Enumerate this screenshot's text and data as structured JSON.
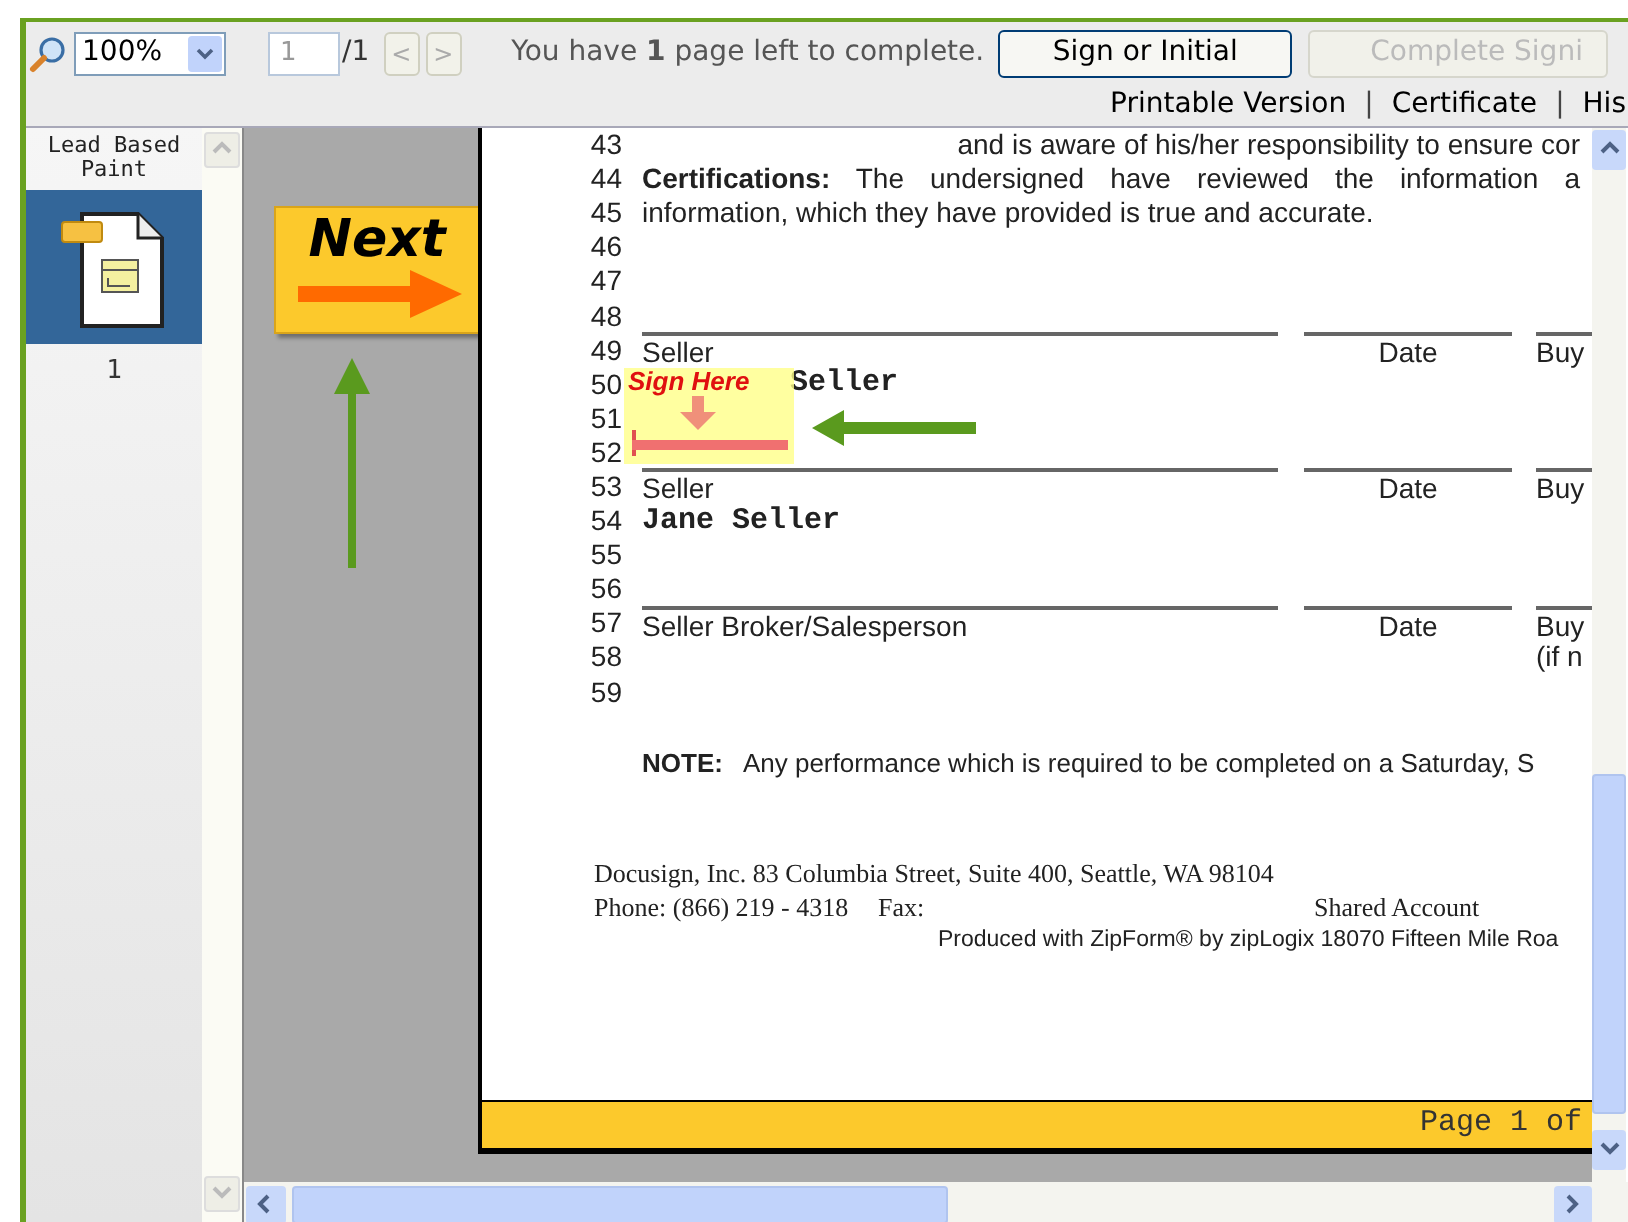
{
  "toolbar": {
    "zoom": "100%",
    "page_input": "1",
    "page_total": "/1",
    "prev": "<",
    "next": ">",
    "message": "You have **1** page left to complete.",
    "buttons": [
      {
        "label": "Sign or Initial",
        "disabled": false
      },
      {
        "label": "Complete Signi",
        "disabled": true
      }
    ],
    "links": [
      {
        "kind": "link",
        "text": "Printable Version"
      },
      {
        "kind": "separator",
        "text": "|"
      },
      {
        "kind": "link",
        "text": "Certificate"
      },
      {
        "kind": "separator",
        "text": "|"
      },
      {
        "kind": "link",
        "text": "His"
      }
    ]
  },
  "sidebar": {
    "title": "Lead Based Paint",
    "pages": [
      {
        "label": "1",
        "selected": true
      }
    ]
  },
  "next_button": "Next",
  "document": {
    "rows": [
      {
        "num": "43",
        "kind": "continued",
        "text": "and is aware of his/her responsibility to ensure cor"
      },
      {
        "num": "44",
        "kind": "justified",
        "text": "**Certifications:** The undersigned have reviewed the information a"
      },
      {
        "num": "45",
        "kind": "text",
        "text": "information, which they have provided is true and accurate."
      },
      {
        "num": "46",
        "kind": "blank"
      },
      {
        "num": "47",
        "kind": "blank"
      },
      {
        "num": "48",
        "kind": "blank"
      },
      {
        "num": "49",
        "kind": "labels",
        "cells": [
          "Seller",
          "Date",
          "Buy"
        ]
      },
      {
        "num": "50",
        "kind": "name",
        "text": "Seller"
      },
      {
        "num": "51",
        "kind": "blank"
      },
      {
        "num": "52",
        "kind": "blank"
      },
      {
        "num": "53",
        "kind": "labels",
        "cells": [
          "Seller",
          "Date",
          "Buy"
        ]
      },
      {
        "num": "54",
        "kind": "name",
        "text": "Jane Seller"
      },
      {
        "num": "55",
        "kind": "blank"
      },
      {
        "num": "56",
        "kind": "blank"
      },
      {
        "num": "57",
        "kind": "labels",
        "cells": [
          "Seller Broker/Salesperson",
          "Date",
          "Buy"
        ]
      },
      {
        "num": "58",
        "kind": "aside",
        "text": "(if n"
      },
      {
        "num": "59",
        "kind": "blank"
      }
    ],
    "sign_tag": "Sign Here",
    "note": {
      "label": "NOTE:",
      "text": "Any performance which is required to be completed on a Saturday, S"
    },
    "footer": {
      "address": "Docusign, Inc. 83 Columbia Street, Suite 400, Seattle, WA  98104",
      "phone": "Phone: (866) 219 - 4318",
      "fax": "Fax:",
      "account": "Shared  Account",
      "produced": "Produced with ZipForm® by zipLogix 18070 Fifteen Mile Roa"
    },
    "page_bar": "Page 1 of"
  }
}
